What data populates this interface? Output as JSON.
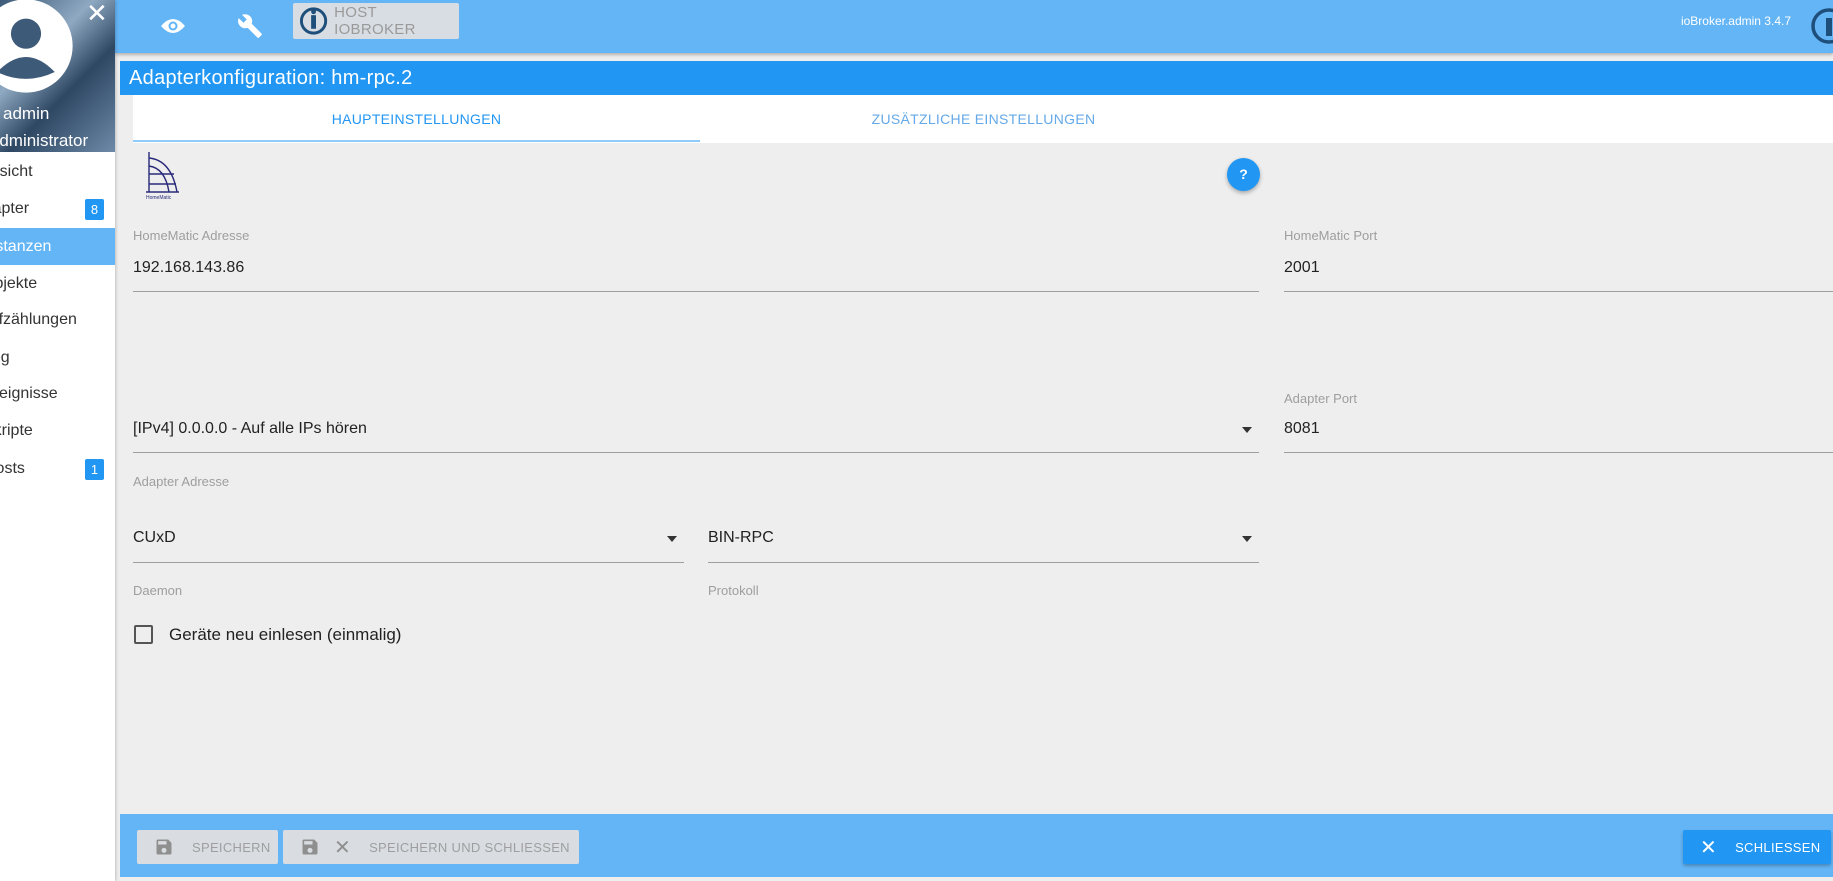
{
  "sidebar": {
    "user_name": "admin",
    "user_role": "Administrator",
    "items": [
      {
        "label": "Übersicht"
      },
      {
        "label": "Adapter",
        "badge": "8"
      },
      {
        "label": "Instanzen",
        "active": true
      },
      {
        "label": "Objekte"
      },
      {
        "label": "Aufzählungen"
      },
      {
        "label": "Log"
      },
      {
        "label": "Ereignisse"
      },
      {
        "label": "Skripte"
      },
      {
        "label": "Hosts",
        "badge": "1"
      }
    ]
  },
  "topbar": {
    "host_label": "HOST IOBROKER",
    "version": "ioBroker.admin 3.4.7"
  },
  "dialog": {
    "title": "Adapterkonfiguration: hm-rpc.2",
    "tabs": [
      {
        "label": "HAUPTEINSTELLUNGEN"
      },
      {
        "label": "ZUSÄTZLICHE EINSTELLUNGEN"
      }
    ],
    "logo_text": "HomeMatic",
    "fields": {
      "hm_address": {
        "label": "HomeMatic Adresse",
        "value": "192.168.143.86"
      },
      "hm_port": {
        "label": "HomeMatic Port",
        "value": "2001"
      },
      "adapter_address": {
        "label": "Adapter Adresse",
        "value": "[IPv4] 0.0.0.0 - Auf alle IPs hören"
      },
      "adapter_port": {
        "label": "Adapter Port",
        "value": "8081"
      },
      "daemon": {
        "label": "Daemon",
        "value": "CUxD"
      },
      "protocol": {
        "label": "Protokoll",
        "value": "BIN-RPC"
      },
      "reread": {
        "label": "Geräte neu einlesen (einmalig)",
        "checked": false
      }
    }
  },
  "footer": {
    "save": "SPEICHERN",
    "save_close": "SPEICHERN UND SCHLIESSEN",
    "close": "SCHLIESSEN"
  },
  "colors": {
    "primary": "#2196f3",
    "bar": "#64b5f6",
    "background": "#eeeeee"
  }
}
